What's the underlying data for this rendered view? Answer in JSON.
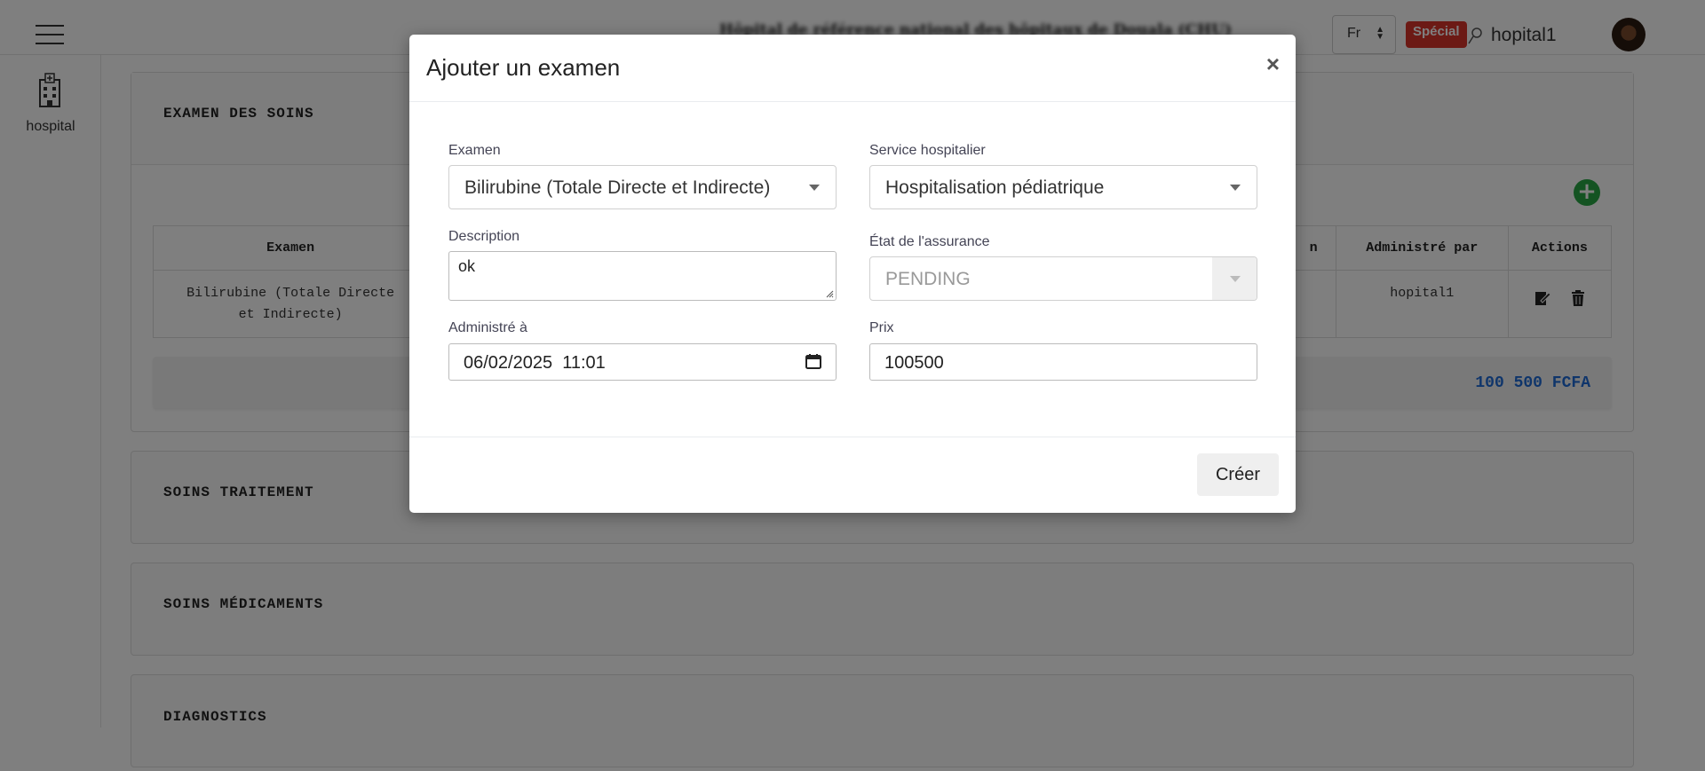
{
  "header": {
    "hospital_name": "Hôpital de référence national des hôpitaux de Douala (CHU)",
    "language": "Fr",
    "badge": "Spécial",
    "username": "hopital1"
  },
  "sidebar": {
    "items": [
      {
        "label": "hospital",
        "icon": "hospital-icon"
      }
    ]
  },
  "sections": {
    "exams": {
      "title": "EXAMEN DES SOINS",
      "columns": [
        "Examen",
        "n",
        "Administré par",
        "Actions"
      ],
      "rows": [
        {
          "exam": "Bilirubine (Totale Directe et Indirecte)",
          "administered_by": "hopital1"
        }
      ],
      "total": "100 500 FCFA"
    },
    "treatment": {
      "title": "SOINS TRAITEMENT"
    },
    "medications": {
      "title": "SOINS MÉDICAMENTS"
    },
    "diagnostics": {
      "title": "DIAGNOSTICS"
    }
  },
  "modal": {
    "title": "Ajouter un examen",
    "close": "×",
    "fields": {
      "exam_label": "Examen",
      "exam_value": "Bilirubine (Totale Directe et Indirecte)",
      "service_label": "Service hospitalier",
      "service_value": "Hospitalisation pédiatrique",
      "description_label": "Description",
      "description_value": "ok",
      "insurance_label": "État de l'assurance",
      "insurance_value": "PENDING",
      "administered_label": "Administré à",
      "administered_value": "06/02/2025  11:01",
      "price_label": "Prix",
      "price_value": "100500"
    },
    "create_label": "Créer"
  },
  "colors": {
    "badge": "#d9342b",
    "add_button": "#28a745",
    "total_text": "#1e6bd6"
  }
}
